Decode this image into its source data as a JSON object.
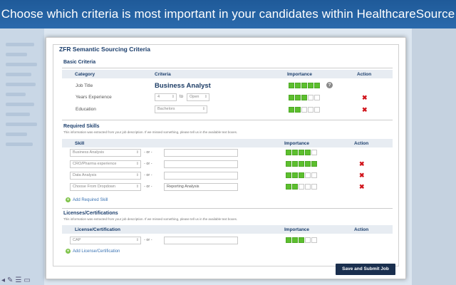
{
  "banner": "Choose which criteria is most important in your candidates within HealthcareSource",
  "modal": {
    "title": "ZFR Semantic Sourcing Criteria",
    "submit_label": "Save and Submit Job"
  },
  "basic": {
    "title": "Basic Criteria",
    "headers": {
      "category": "Category",
      "criteria": "Criteria",
      "importance": "Importance",
      "action": "Action"
    },
    "job_title": {
      "label": "Job Title",
      "value": "Business Analyst",
      "importance": 5
    },
    "years": {
      "label": "Years Experience",
      "from": "4",
      "to_label": "to",
      "to": "Open",
      "importance": 3
    },
    "education": {
      "label": "Education",
      "value": "Bachelors",
      "importance": 2
    }
  },
  "skills": {
    "title": "Required Skills",
    "note": "This information was extracted from your job description. If we missed something, please tell us in the available text boxes.",
    "headers": {
      "skill": "Skill",
      "importance": "Importance",
      "action": "Action"
    },
    "or_label": "- or -",
    "rows": [
      {
        "select": "Business Analysis",
        "text": "",
        "importance": 4,
        "removable": false
      },
      {
        "select": "CRO/Pharma experience",
        "text": "",
        "importance": 5,
        "removable": true
      },
      {
        "select": "Data Analysis",
        "text": "",
        "importance": 3,
        "removable": true
      },
      {
        "select": "Choose From Dropdown",
        "text": "Reporting Analysis",
        "importance": 2,
        "removable": true
      }
    ],
    "add_label": "Add Required Skill"
  },
  "licenses": {
    "title": "Licenses/Certifications",
    "note": "This information was extracted from your job description. If we missed something, please tell us in the available text boxes.",
    "headers": {
      "license": "License/Certification",
      "importance": "Importance",
      "action": "Action"
    },
    "or_label": "- or -",
    "rows": [
      {
        "select": "CAP",
        "text": "",
        "importance": 3
      }
    ],
    "add_label": "Add License/Certification"
  },
  "icons": {
    "remove": "close-x-icon",
    "help": "help-question-icon",
    "add": "plus-circle-icon",
    "dropdown": "chevron-updown-icon"
  },
  "colors": {
    "banner": "#2164a5",
    "importance_on": "#5cbf2e",
    "remove": "#d1141b",
    "submit": "#1a2f4e",
    "section_title": "#1b3e6c"
  }
}
